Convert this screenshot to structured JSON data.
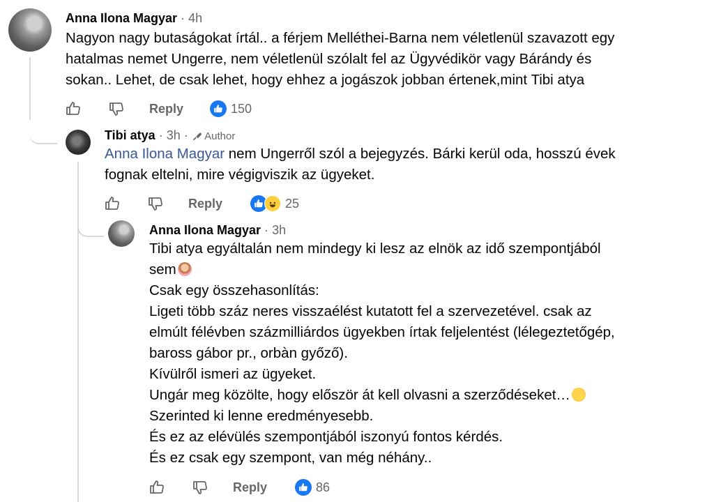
{
  "comments": [
    {
      "author": "Anna Ilona Magyar",
      "separator": "·",
      "time": "4h",
      "lines": [
        "Nagyon nagy butaságokat írtál.. a férjem Melléthei-Barna nem véletlenül szavazott egy",
        "hatalmas nemet Ungerre, nem véletlenül szólalt fel az Ügyvédikör vagy Bárándy és",
        "sokan.. Lehet, de csak lehet, hogy ehhez a jogászok jobban értenek,mint Tibi atya"
      ],
      "reply_label": "Reply",
      "reaction_count": "150"
    },
    {
      "author": "Tibi atya",
      "separator": "·",
      "time": "3h",
      "separator2": "·",
      "author_badge": "Author",
      "mention": "Anna Ilona Magyar",
      "line1_rest": " nem Ungerről szól a bejegyzés. Bárki kerül oda, hosszú évek",
      "line2": "fognak eltelni, mire végigviszik az ügyeket.",
      "reply_label": "Reply",
      "reaction_count": "25"
    },
    {
      "author": "Anna Ilona Magyar",
      "separator": "·",
      "time": "3h",
      "lines": [
        "Tibi atya egyáltalán nem mindegy ki lesz az elnök az idő szempontjából",
        "sem",
        "Csak egy összehasonlítás:",
        "Ligeti több száz neres visszaélést kutatott fel a szervezetével. csak az",
        "elmúlt félévben százmilliárdos ügyekben írtak feljelentést (lélegeztetőgép,",
        "baross gábor pr., orbàn győző).",
        "Kívülről ismeri az ügyeket.",
        "Ungár meg közölte, hogy először át kell olvasni a szerződéseket…",
        "Szerinted ki lenne eredményesebb.",
        "És ez az elévülés szempontjából iszonyú fontos kérdés.",
        "És ez csak egy szempont, van még néhány.."
      ],
      "reply_label": "Reply",
      "reaction_count": "86"
    }
  ],
  "icons": {
    "like": "thumbs-up-outline-icon",
    "dislike": "thumbs-down-outline-icon",
    "like_reaction": "like-reaction-icon",
    "haha_reaction": "haha-reaction-icon",
    "author": "author-badge-icon"
  },
  "colors": {
    "accent": "#1877f2",
    "mention": "#385898",
    "secondary_text": "#65676b",
    "thread_line": "#d6d8dc"
  }
}
